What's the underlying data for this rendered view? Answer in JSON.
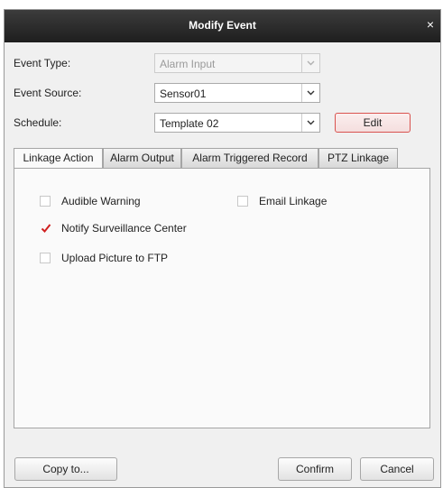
{
  "dialog": {
    "title": "Modify Event",
    "close_glyph": "×"
  },
  "form": {
    "event_type": {
      "label": "Event Type:",
      "value": "Alarm Input",
      "disabled": true
    },
    "event_source": {
      "label": "Event Source:",
      "value": "Sensor01"
    },
    "schedule": {
      "label": "Schedule:",
      "value": "Template 02",
      "edit_label": "Edit"
    }
  },
  "tabs": [
    {
      "label": "Linkage Action",
      "active": true
    },
    {
      "label": "Alarm Output"
    },
    {
      "label": "Alarm Triggered Record"
    },
    {
      "label": "PTZ Linkage"
    }
  ],
  "linkage_options": [
    {
      "label": "Audible Warning",
      "checked": false
    },
    {
      "label": "Email Linkage",
      "checked": false
    },
    {
      "label": "Notify Surveillance Center",
      "checked": true
    },
    {
      "label": "Upload Picture to FTP",
      "checked": false
    }
  ],
  "footer": {
    "copy_to": "Copy to...",
    "confirm": "Confirm",
    "cancel": "Cancel"
  },
  "colors": {
    "titlebar": "#2b2b2b",
    "accent_red": "#d9534f",
    "checkmark": "#d01f1f"
  }
}
